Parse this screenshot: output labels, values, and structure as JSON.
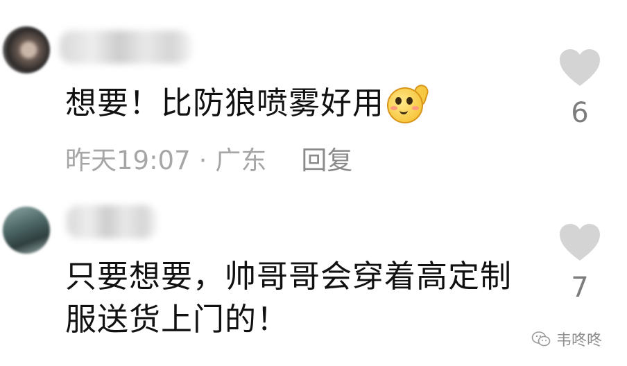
{
  "comments": [
    {
      "username": "",
      "text": "想要！比防狼喷雾好用",
      "emoji_icon": "thinking-blush-emoji-icon",
      "time": "昨天19:07",
      "separator": "·",
      "location": "广东",
      "reply_label": "回复",
      "like_count": "6"
    },
    {
      "username": "",
      "text": "只要想要，帅哥哥会穿着高定制服送货上门的！",
      "like_count": "7"
    }
  ],
  "watermark": {
    "text": "韦咚咚",
    "icon": "wechat-icon"
  },
  "colors": {
    "text": "#111111",
    "meta": "#a6a6a6",
    "heart": "#d4d4d4",
    "count": "#7d7d7d"
  }
}
